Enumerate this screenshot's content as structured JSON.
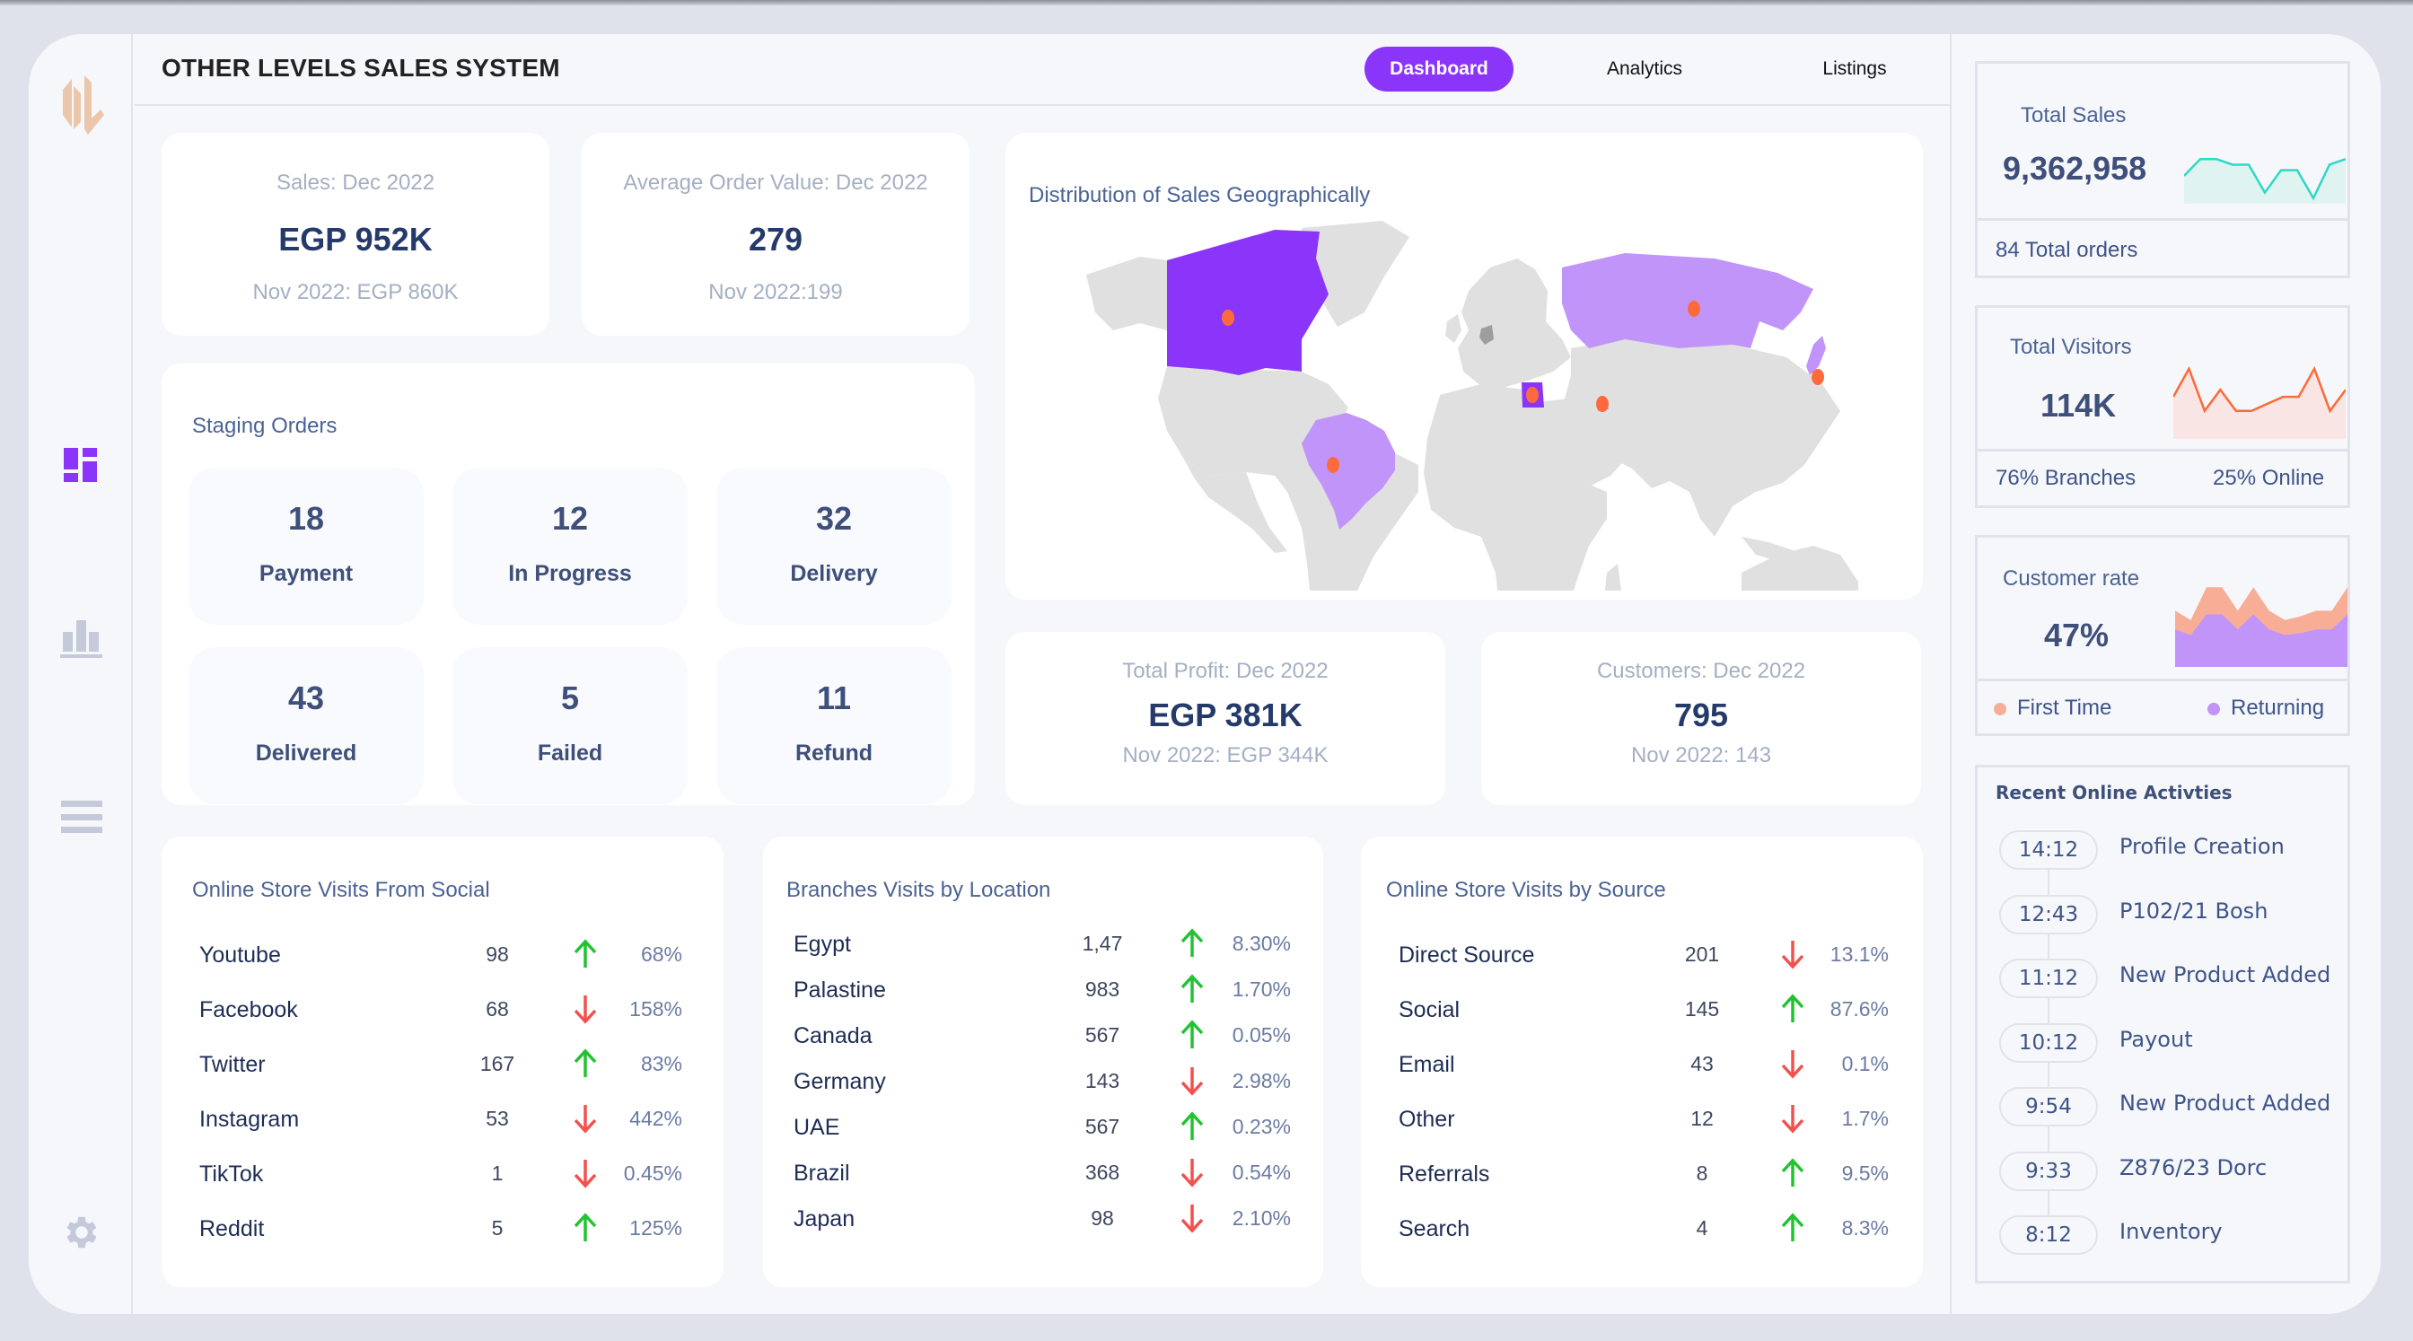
{
  "app": {
    "title": "OTHER LEVELS SALES SYSTEM",
    "logo": "OL-logo",
    "accent_color": "#8b35fb"
  },
  "nav": {
    "tabs": [
      {
        "label": "Dashboard",
        "active": true
      },
      {
        "label": "Analytics",
        "active": false
      },
      {
        "label": "Listings",
        "active": false
      }
    ]
  },
  "sidebar": {
    "items": [
      {
        "icon": "dashboard-icon",
        "active": true
      },
      {
        "icon": "bar-chart-icon",
        "active": false
      },
      {
        "icon": "menu-icon",
        "active": false
      },
      {
        "icon": "gear-icon",
        "active": false
      }
    ]
  },
  "kpis": {
    "sales": {
      "label": "Sales: Dec 2022",
      "value": "EGP 952K",
      "previous": "Nov 2022: EGP 860K"
    },
    "aov": {
      "label": "Average Order Value: Dec 2022",
      "value": "279",
      "previous": "Nov 2022:199"
    },
    "profit": {
      "label": "Total Profit: Dec 2022",
      "value": "EGP 381K",
      "previous": "Nov 2022: EGP 344K"
    },
    "customers": {
      "label": "Customers: Dec 2022",
      "value": "795",
      "previous": "Nov 2022: 143"
    }
  },
  "staging": {
    "title": "Staging Orders",
    "items": [
      {
        "count": "18",
        "label": "Payment"
      },
      {
        "count": "12",
        "label": "In Progress"
      },
      {
        "count": "32",
        "label": "Delivery"
      },
      {
        "count": "43",
        "label": "Delivered"
      },
      {
        "count": "5",
        "label": "Failed"
      },
      {
        "count": "11",
        "label": "Refund"
      }
    ]
  },
  "map": {
    "title": "Distribution of Sales Geographically",
    "highlighted": [
      {
        "country": "Canada",
        "shade": "dark",
        "marker": true
      },
      {
        "country": "Egypt",
        "shade": "dark",
        "marker": true
      },
      {
        "country": "Russia",
        "shade": "light",
        "marker": true
      },
      {
        "country": "Brazil",
        "shade": "light",
        "marker": true
      },
      {
        "country": "UAE",
        "shade": "light",
        "marker": true
      },
      {
        "country": "Japan",
        "shade": "light",
        "marker": true
      },
      {
        "country": "Germany",
        "shade": "grey",
        "marker": false
      }
    ],
    "colors": {
      "dark": "#8b35fb",
      "light": "#c194f9",
      "grey": "#9e9e9e",
      "land": "#e0e0e0",
      "marker": "#ff6a3d"
    }
  },
  "social": {
    "title": "Online Store Visits From Social",
    "rows": [
      {
        "name": "Youtube",
        "value": "98",
        "trend": "up",
        "pct": "68%"
      },
      {
        "name": "Facebook",
        "value": "68",
        "trend": "down",
        "pct": "158%"
      },
      {
        "name": "Twitter",
        "value": "167",
        "trend": "up",
        "pct": "83%"
      },
      {
        "name": "Instagram",
        "value": "53",
        "trend": "down",
        "pct": "442%"
      },
      {
        "name": "TikTok",
        "value": "1",
        "trend": "down",
        "pct": "0.45%"
      },
      {
        "name": "Reddit",
        "value": "5",
        "trend": "up",
        "pct": "125%"
      }
    ]
  },
  "branches": {
    "title": "Branches Visits by Location",
    "rows": [
      {
        "name": "Egypt",
        "value": "1,47",
        "trend": "up",
        "pct": "8.30%"
      },
      {
        "name": "Palastine",
        "value": "983",
        "trend": "up",
        "pct": "1.70%"
      },
      {
        "name": "Canada",
        "value": "567",
        "trend": "up",
        "pct": "0.05%"
      },
      {
        "name": "Germany",
        "value": "143",
        "trend": "down",
        "pct": "2.98%"
      },
      {
        "name": "UAE",
        "value": "567",
        "trend": "up",
        "pct": "0.23%"
      },
      {
        "name": "Brazil",
        "value": "368",
        "trend": "down",
        "pct": "0.54%"
      },
      {
        "name": "Japan",
        "value": "98",
        "trend": "down",
        "pct": "2.10%"
      }
    ]
  },
  "sources": {
    "title": "Online Store Visits by Source",
    "rows": [
      {
        "name": "Direct Source",
        "value": "201",
        "trend": "down",
        "pct": "13.1%"
      },
      {
        "name": "Social",
        "value": "145",
        "trend": "up",
        "pct": "87.6%"
      },
      {
        "name": "Email",
        "value": "43",
        "trend": "down",
        "pct": "0.1%"
      },
      {
        "name": "Other",
        "value": "12",
        "trend": "down",
        "pct": "1.7%"
      },
      {
        "name": "Referrals",
        "value": "8",
        "trend": "up",
        "pct": "9.5%"
      },
      {
        "name": "Search",
        "value": "4",
        "trend": "up",
        "pct": "8.3%"
      }
    ]
  },
  "trend_colors": {
    "up": "#22c232",
    "down": "#f2514e"
  },
  "right": {
    "total_sales": {
      "label": "Total Sales",
      "value": "9,362,958",
      "footer": "84 Total orders",
      "sparkline": [
        5,
        8,
        8,
        7,
        7,
        2,
        6,
        6,
        1,
        7,
        8
      ],
      "color": "#2fd8c4",
      "fill": "#dff4f1"
    },
    "total_visitors": {
      "label": "Total Visitors",
      "value": "114K",
      "footer_left": "76%  Branches",
      "footer_right": "25%  Online",
      "sparkline": [
        6,
        10,
        4,
        7,
        4,
        4,
        5,
        6,
        6,
        10,
        4,
        7
      ],
      "color": "#fb6a3a",
      "fill": "#f9e5e3"
    },
    "customer_rate": {
      "label": "Customer rate",
      "value": "47%",
      "legend": [
        {
          "label": "First Time",
          "color": "#f8ae96"
        },
        {
          "label": "Returning",
          "color": "#c194f9"
        }
      ],
      "first_time": [
        6,
        5,
        8.5,
        8.5,
        6,
        8.5,
        6,
        5,
        5.4,
        6,
        6,
        8.5
      ],
      "returning": [
        4,
        3.4,
        5.6,
        5.6,
        4,
        5.6,
        4,
        3.4,
        3.6,
        4,
        4,
        5.6
      ]
    },
    "recent": {
      "title": "Recent Online Activties",
      "items": [
        {
          "time": "14:12",
          "desc": "Profile Creation"
        },
        {
          "time": "12:43",
          "desc": "P102/21 Bosh"
        },
        {
          "time": "11:12",
          "desc": "New Product Added"
        },
        {
          "time": "10:12",
          "desc": "Payout"
        },
        {
          "time": "9:54",
          "desc": "New Product Added"
        },
        {
          "time": "9:33",
          "desc": "Z876/23 Dorc"
        },
        {
          "time": "8:12",
          "desc": "Inventory"
        }
      ]
    }
  }
}
